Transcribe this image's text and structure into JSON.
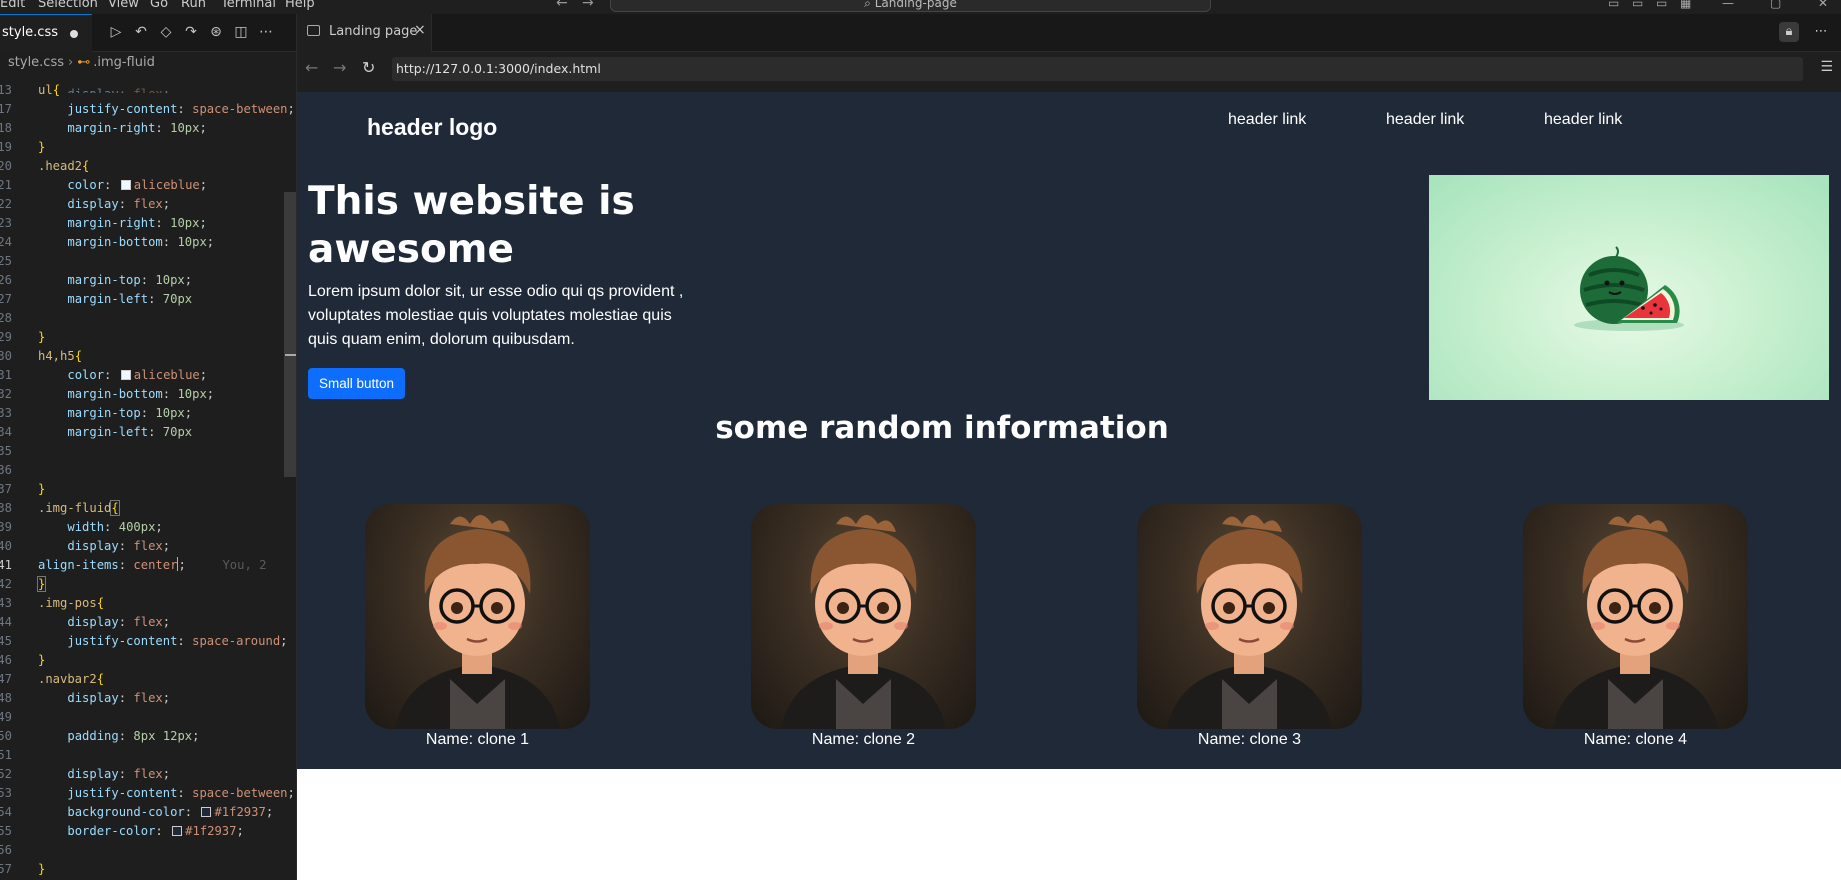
{
  "menubar": {
    "items": [
      "Edit",
      "Selection",
      "View",
      "Go",
      "Run",
      "Terminal",
      "Help"
    ],
    "command_center": "Landing-page"
  },
  "editor": {
    "tab_name": "style.css",
    "breadcrumb": {
      "file": "style.css",
      "symbol": ".img-fluid"
    },
    "ghost_blame": "You, 2"
  },
  "browser": {
    "tab_title": "Landing page",
    "tab_close": "×",
    "url": "http://127.0.0.1:3000/index.html"
  },
  "site": {
    "logo": "header logo",
    "nav_links": [
      "header link",
      "header link",
      "header link"
    ],
    "hero_title": "This website is awesome",
    "hero_text": "Lorem ipsum dolor sit, ur esse odio qui qs provident , voluptates molestiae quis voluptates molestiae quis quis quam enim, dolorum quibusdam.",
    "button_label": "Small button",
    "section_title": "some random information",
    "cards": [
      {
        "name": "Name: clone 1"
      },
      {
        "name": "Name: clone 2"
      },
      {
        "name": "Name: clone 3"
      },
      {
        "name": "Name: clone 4"
      }
    ]
  }
}
